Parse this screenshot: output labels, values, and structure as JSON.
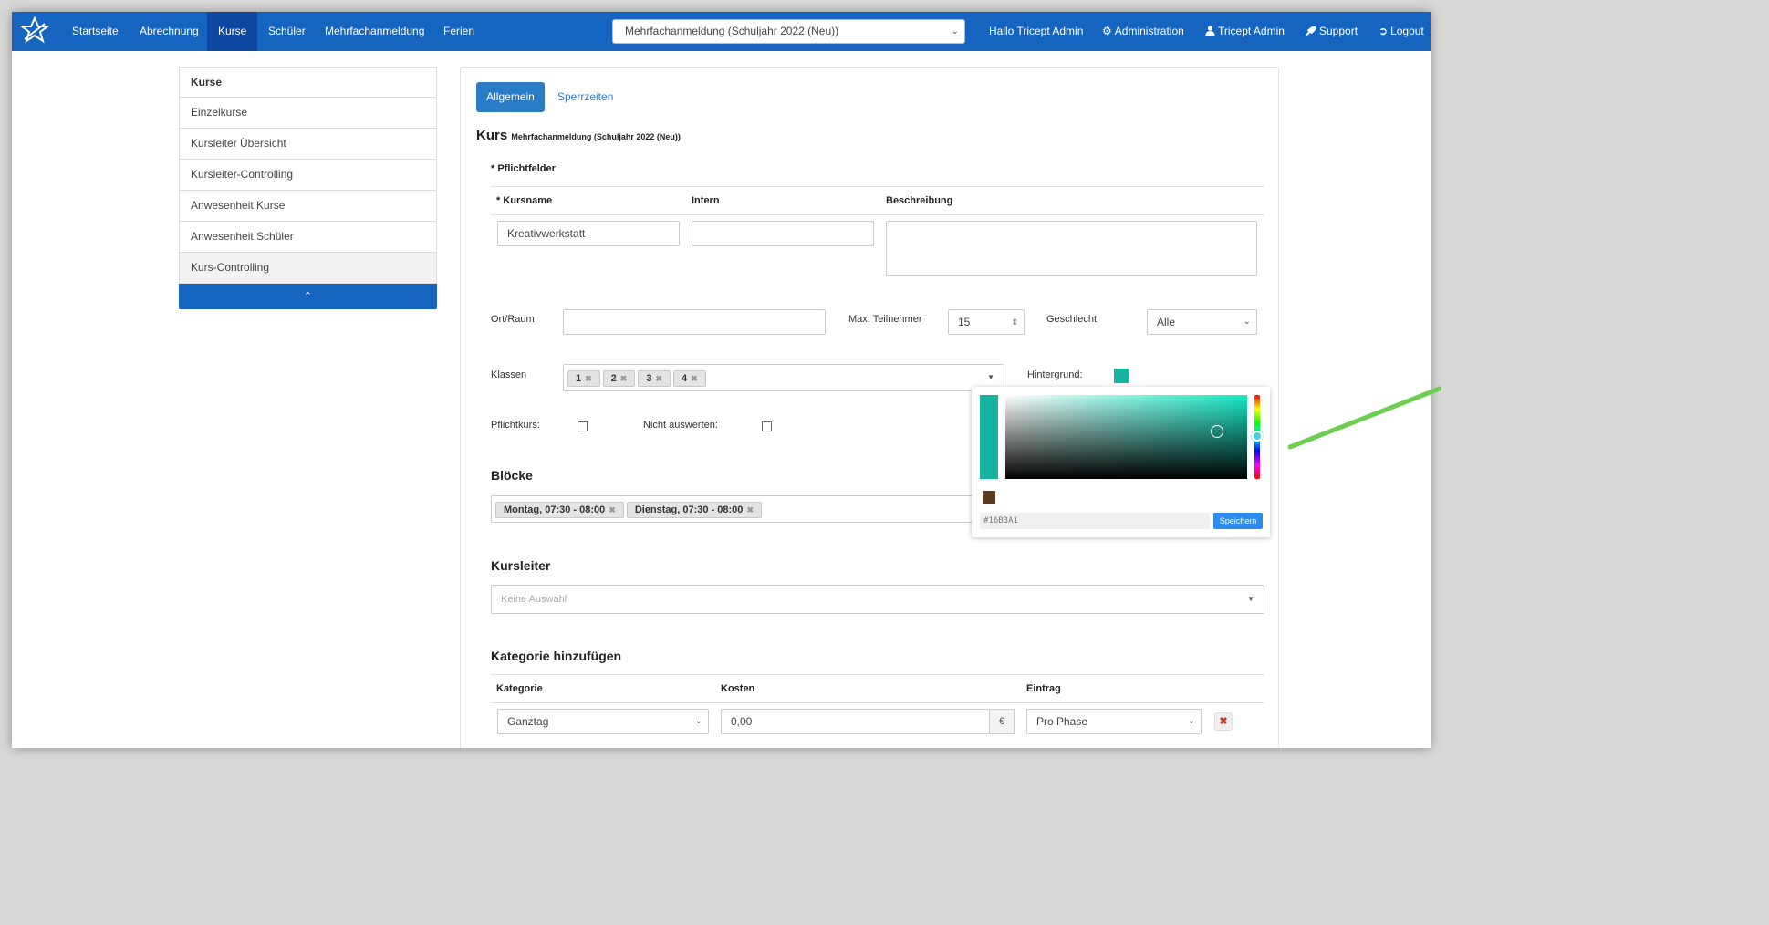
{
  "nav": {
    "items": [
      "Startseite",
      "Abrechnung",
      "Kurse",
      "Schüler",
      "Mehrfachanmeldung",
      "Ferien"
    ],
    "active": "Kurse",
    "registration_select": "Mehrfachanmeldung (Schuljahr 2022 (Neu))",
    "greeting": "Hallo Tricept Admin",
    "admin": "Administration",
    "user": "Tricept Admin",
    "support": "Support",
    "logout": "Logout",
    "brand_color": "#1565c0"
  },
  "sidebar": {
    "items": [
      "Kurse",
      "Einzelkurse",
      "Kursleiter Übersicht",
      "Kursleiter-Controlling",
      "Anwesenheit Kurse",
      "Anwesenheit Schüler",
      "Kurs-Controlling"
    ],
    "collapse_icon": "chevron-up-icon"
  },
  "tabs": {
    "active": "Allgemein",
    "other": "Sperrzeiten"
  },
  "form": {
    "title": "Kurs",
    "subtitle": "Mehrfachanmeldung (Schuljahr 2022 (Neu))",
    "required_note": "* Pflichtfelder",
    "col_kursname": "* Kursname",
    "col_intern": "Intern",
    "col_beschreibung": "Beschreibung",
    "kursname_value": "Kreativwerkstatt",
    "intern_value": "",
    "beschreibung_value": "",
    "ort_label": "Ort/Raum",
    "ort_value": "",
    "max_label": "Max. Teilnehmer",
    "max_value": "15",
    "geschlecht_label": "Geschlecht",
    "geschlecht_value": "Alle",
    "klassen_label": "Klassen",
    "klassen": [
      "1",
      "2",
      "3",
      "4"
    ],
    "hintergrund_label": "Hintergrund:",
    "hintergrund_color": "#16B3A1",
    "pflichtkurs_label": "Pflichtkurs:",
    "pflichtkurs_checked": false,
    "nicht_auswerten_label": "Nicht auswerten:",
    "nicht_auswerten_checked": false
  },
  "picker": {
    "hex": "#16B3A1",
    "save": "Speichern",
    "current_color": "#16B3A1",
    "previous_color": "#5c3a1e"
  },
  "bloecke": {
    "title": "Blöcke",
    "tags": [
      "Montag, 07:30 - 08:00",
      "Dienstag, 07:30 - 08:00"
    ]
  },
  "kursleiter": {
    "title": "Kursleiter",
    "placeholder": "Keine Auswahl"
  },
  "kategorie": {
    "title": "Kategorie hinzufügen",
    "col_kategorie": "Kategorie",
    "col_kosten": "Kosten",
    "col_eintrag": "Eintrag",
    "kategorie_value": "Ganztag",
    "kosten_value": "0,00",
    "currency": "€",
    "eintrag_value": "Pro Phase"
  }
}
